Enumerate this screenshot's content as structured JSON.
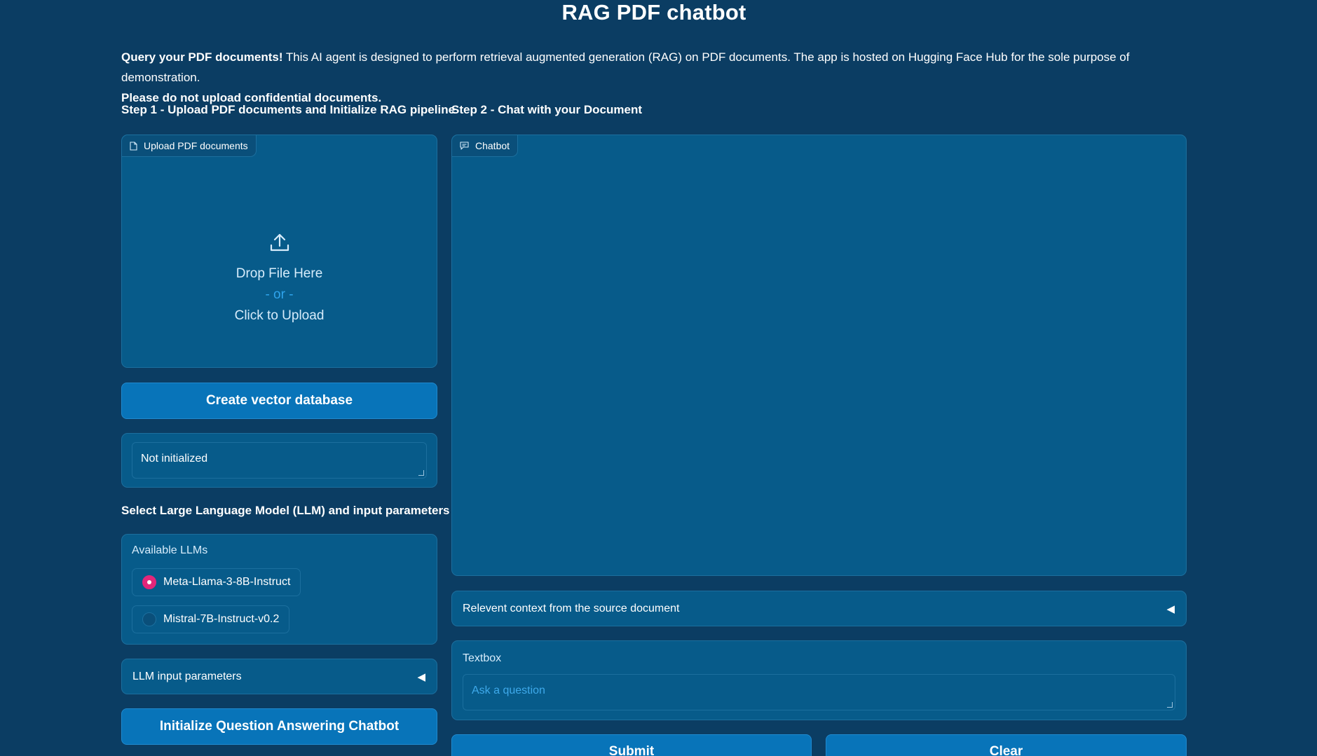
{
  "page": {
    "title": "RAG PDF chatbot"
  },
  "intro": {
    "bold_lead": "Query your PDF documents!",
    "text": " This AI agent is designed to perform retrieval augmented generation (RAG) on PDF documents. The app is hosted on Hugging Face Hub for the sole purpose of demonstration.",
    "warning": "Please do not upload confidential documents."
  },
  "step1": {
    "label": "Step 1 - Upload PDF documents and Initialize RAG pipeline",
    "upload": {
      "tag": "Upload PDF documents",
      "drop": "Drop File Here",
      "or": "- or -",
      "click": "Click to Upload"
    },
    "create_db_button": "Create vector database",
    "status_value": "Not initialized",
    "llm_section_label": "Select Large Language Model (LLM) and input parameters",
    "llm_group_label": "Available LLMs",
    "llm_options": [
      "Meta-Llama-3-8B-Instruct",
      "Mistral-7B-Instruct-v0.2"
    ],
    "llm_selected": "Meta-Llama-3-8B-Instruct",
    "llm_params_accordion": "LLM input parameters",
    "init_chatbot_button": "Initialize Question Answering Chatbot"
  },
  "step2": {
    "label": "Step 2 - Chat with your Document",
    "chatbot_tag": "Chatbot",
    "context_accordion": "Relevent context from the source document",
    "textbox_label": "Textbox",
    "textbox_placeholder": "Ask a question",
    "submit_button": "Submit",
    "clear_button": "Clear"
  },
  "icons": {
    "accordion_caret": "caret-left-icon",
    "upload": "upload-icon",
    "file": "file-icon",
    "chat": "chat-icon"
  },
  "colors": {
    "background": "#0b3d63",
    "panel": "#075b8a",
    "button": "#0874b9",
    "radio_checked": "#e3267a",
    "accent_text": "#2fa4ec"
  }
}
